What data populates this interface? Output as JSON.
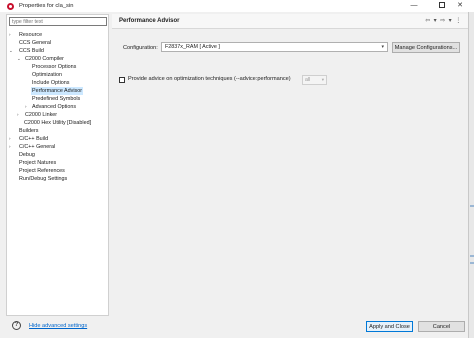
{
  "window": {
    "title": "Properties for cla_sin",
    "minimize_glyph": "—",
    "close_glyph": "✕"
  },
  "nav": {
    "filter_placeholder": "type filter text",
    "items": [
      {
        "label": "Resource",
        "twisty": "›"
      },
      {
        "label": "CCS General",
        "twisty": ""
      },
      {
        "label": "CCS Build",
        "twisty": "⌄"
      },
      {
        "label": "C2000 Compiler",
        "twisty": "⌄"
      },
      {
        "label": "Processor Options",
        "twisty": ""
      },
      {
        "label": "Optimization",
        "twisty": ""
      },
      {
        "label": "Include Options",
        "twisty": ""
      },
      {
        "label": "Performance Advisor",
        "twisty": "",
        "selected": true
      },
      {
        "label": "Predefined Symbols",
        "twisty": ""
      },
      {
        "label": "Advanced Options",
        "twisty": "›"
      },
      {
        "label": "C2000 Linker",
        "twisty": "›"
      },
      {
        "label": "C2000 Hex Utility  [Disabled]",
        "twisty": ""
      },
      {
        "label": "Builders",
        "twisty": ""
      },
      {
        "label": "C/C++ Build",
        "twisty": "›"
      },
      {
        "label": "C/C++ General",
        "twisty": "›"
      },
      {
        "label": "Debug",
        "twisty": ""
      },
      {
        "label": "Project Natures",
        "twisty": ""
      },
      {
        "label": "Project References",
        "twisty": ""
      },
      {
        "label": "Run/Debug Settings",
        "twisty": ""
      }
    ]
  },
  "page": {
    "title": "Performance Advisor",
    "nav_arrows": "⇦ ▾ ⇨ ▾ ⋮",
    "configuration_label": "Configuration:",
    "configuration_value": "F2837x_RAM  [ Active ]",
    "manage_button": "Manage Configurations...",
    "advice_label": "Provide advice on optimization techniques (--advice:performance)",
    "advice_value": "all",
    "dropdown_glyph": "▾"
  },
  "footer": {
    "help_glyph": "?",
    "hide_advanced": "Hide advanced settings",
    "apply_close": "Apply and Close",
    "cancel": "Cancel"
  }
}
